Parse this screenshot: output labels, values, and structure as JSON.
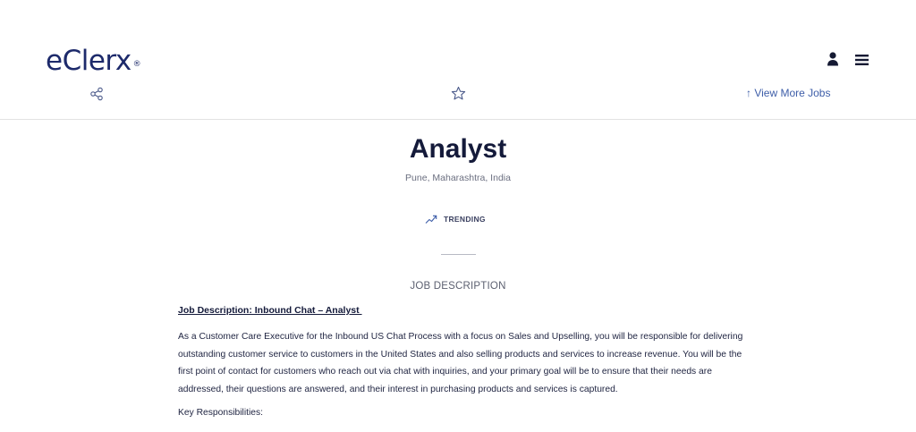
{
  "header": {
    "logo": "eClerx",
    "logo_mark": "®",
    "icons": {
      "user": "user-icon",
      "menu": "hamburger-menu-icon",
      "share": "share-icon",
      "favorite": "star-icon"
    },
    "view_more_jobs": "↑ View More Jobs"
  },
  "job": {
    "title": "Analyst",
    "location": "Pune, Maharashtra, India",
    "trending_label": "TRENDING",
    "trending_icon": "trending-up-icon",
    "section_title": "JOB DESCRIPTION",
    "description_heading": "Job Description: Inbound Chat – Analyst ",
    "description_paragraph": "As a Customer Care Executive for the Inbound US Chat Process with a focus on Sales and Upselling, you will be responsible for delivering outstanding customer service to customers in the United States and also selling products and services to increase revenue. You will be the first point of contact for customers who reach out via chat with inquiries, and your primary goal will be to ensure that their needs are addressed, their questions are answered, and their interest in purchasing products and services is captured.",
    "key_responsibilities_label": "Key Responsibilities:"
  },
  "colors": {
    "brand": "#1d2a6b",
    "link": "#3d5da8",
    "text": "#1e2340",
    "muted": "#6b6f80"
  }
}
